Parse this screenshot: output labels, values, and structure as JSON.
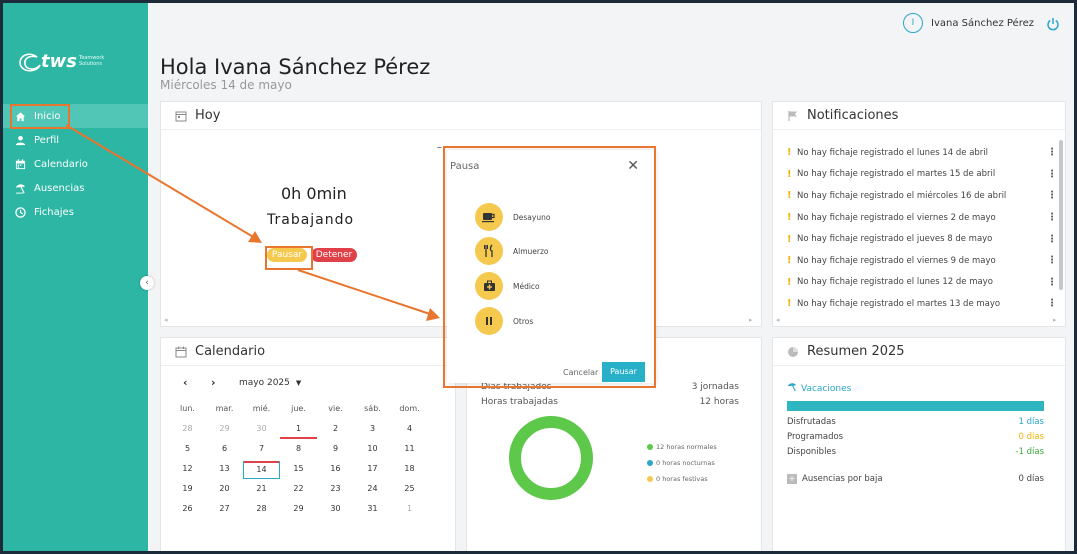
{
  "brand": {
    "logo_text": "tws",
    "logo_sub": "Teamwork Solutions"
  },
  "sidebar": {
    "items": [
      {
        "label": "Inicio",
        "icon": "home-icon",
        "active": true
      },
      {
        "label": "Perfil",
        "icon": "user-icon"
      },
      {
        "label": "Calendario",
        "icon": "calendar-icon"
      },
      {
        "label": "Ausencias",
        "icon": "umbrella-icon"
      },
      {
        "label": "Fichajes",
        "icon": "clock-icon"
      }
    ]
  },
  "header": {
    "avatar_initial": "I",
    "user_name": "Ivana Sánchez Pérez",
    "greeting": "Hola Ivana Sánchez Pérez",
    "date": "Miércoles 14 de mayo"
  },
  "hoy": {
    "title": "Hoy",
    "time": "0h 0min",
    "status": "Trabajando",
    "pause_label": "Pausar",
    "stop_label": "Detener",
    "dash": "–"
  },
  "notifications": {
    "title": "Notificaciones",
    "items": [
      "No hay fichaje registrado el lunes 14 de abril",
      "No hay fichaje registrado el martes 15 de abril",
      "No hay fichaje registrado el miércoles 16 de abril",
      "No hay fichaje registrado el viernes 2 de mayo",
      "No hay fichaje registrado el jueves 8 de mayo",
      "No hay fichaje registrado el viernes 9 de mayo",
      "No hay fichaje registrado el lunes 12 de mayo",
      "No hay fichaje registrado el martes 13 de mayo"
    ]
  },
  "calendar": {
    "title": "Calendario",
    "month": "mayo 2025",
    "weekdays": [
      "lun.",
      "mar.",
      "mié.",
      "jue.",
      "vie.",
      "sáb.",
      "dom."
    ],
    "weeks": [
      [
        "28",
        "29",
        "30",
        "1",
        "2",
        "3",
        "4"
      ],
      [
        "5",
        "6",
        "7",
        "8",
        "9",
        "10",
        "11"
      ],
      [
        "12",
        "13",
        "14",
        "15",
        "16",
        "17",
        "18"
      ],
      [
        "19",
        "20",
        "21",
        "22",
        "23",
        "24",
        "25"
      ],
      [
        "26",
        "27",
        "28",
        "29",
        "30",
        "31",
        "1"
      ]
    ],
    "today": "14"
  },
  "stats": {
    "days_label": "Días trabajados",
    "days_value": "3 jornadas",
    "hours_label": "Horas trabajadas",
    "hours_value": "12 horas",
    "legend": [
      {
        "label": "12 horas normales",
        "color": "#5dc84a"
      },
      {
        "label": "0 horas nocturnas",
        "color": "#2aa6c6"
      },
      {
        "label": "0 horas festivas",
        "color": "#f5c84e"
      }
    ]
  },
  "resumen": {
    "title": "Resumen 2025",
    "vacaciones": "Vacaciones",
    "rows": [
      {
        "label": "Disfrutadas",
        "value": "1 días"
      },
      {
        "label": "Programados",
        "value": "0 días"
      },
      {
        "label": "Disponibles",
        "value": "-1 días"
      }
    ],
    "bajas_label": "Ausencias por baja",
    "bajas_value": "0 días"
  },
  "modal": {
    "title": "Pausa",
    "options": [
      {
        "label": "Desayuno",
        "icon": "coffee-icon"
      },
      {
        "label": "Almuerzo",
        "icon": "cutlery-icon"
      },
      {
        "label": "Médico",
        "icon": "medical-kit-icon"
      },
      {
        "label": "Otros",
        "icon": "pause-icon"
      }
    ],
    "cancel_label": "Cancelar",
    "confirm_label": "Pausar"
  },
  "colors": {
    "sidebar": "#2db6a3",
    "accent": "#28b0c8",
    "pause": "#f5c84e",
    "stop": "#e04048",
    "annotation": "#e8762f"
  }
}
